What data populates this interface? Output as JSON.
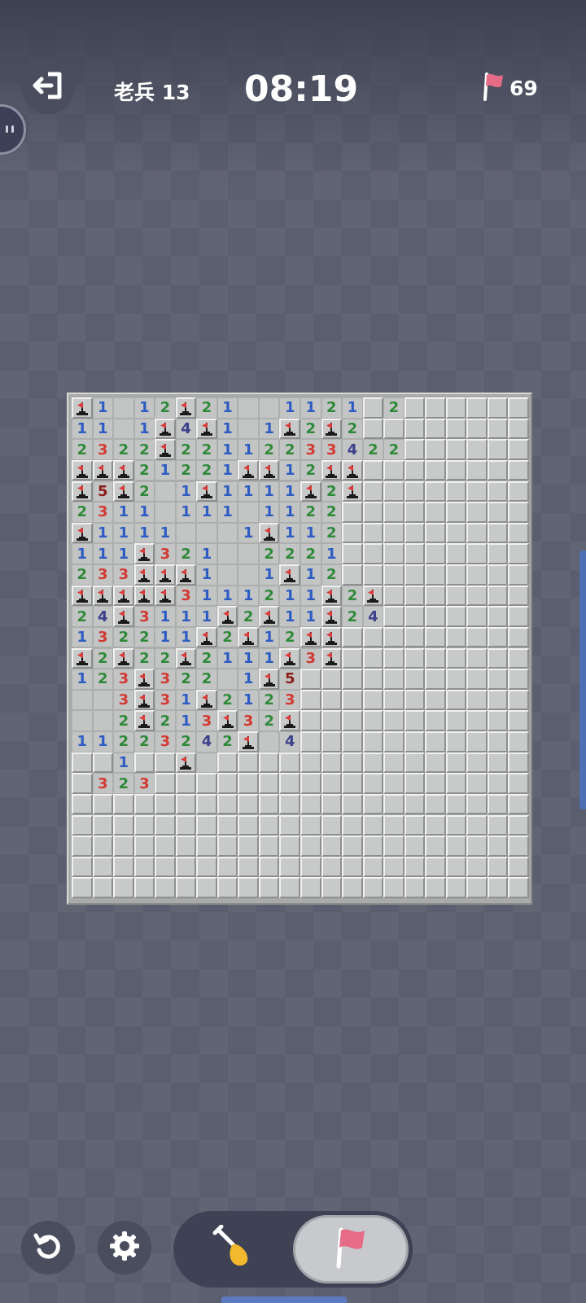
{
  "header": {
    "level_label": "老兵 13",
    "timer": "08:19",
    "flags_remaining": "69"
  },
  "board": {
    "cols": 22,
    "rows": 24,
    "rows_data": [
      "F1.12F21..1121H2HHHHHHHH",
      "11.1F4F1.1F2F2HHHHHHHHHH",
      "2322F22112233422HHHHHHHH",
      "FFF21221FF12FFHHHHHHHHHH",
      "F5F2.1F1111F2FHHHHHHHHHH",
      "2311.111.1122HHHHHHHHHHH",
      "F1111...1F112HHHHHHHHHHH",
      "111F321..2221HHHHHHHHHHH",
      "233FFF1..1F12HHHHHHHHHHH",
      "FFFFF3111211F2FHHHHHHHHH",
      "24F3111F2F11F24HHHHHHHHH",
      "132211F2F12FFHHHHHHHHHHH",
      "F2F22F2111F3FHHHHHHHHHHH",
      "123F322.1F5HHHHHHHHHHHHH",
      "..3F31F2123HHHHHHHHHHHHH",
      "..2F213F32FHHHHHHHHHHHHH",
      "11223242F.4HHHHHHHHHHHHH",
      "HH1HHF.HHHHHHHHHHHHHHHHH",
      "H323HHHHHHHHHHHHHHHHHHHH",
      "HHHHHHHHHHHHHHHHHHHHHHHH",
      "HHHHHHHHHHHHHHHHHHHHHHHH",
      "HHHHHHHHHHHHHHHHHHHHHHHH",
      "HHHHHHHHHHHHHHHHHHHHHHHH",
      "HHHHHHHHHHHHHHHHHHHHHHHH"
    ]
  },
  "controls": {
    "mode": "flag"
  },
  "icons": {
    "exit": "exit-icon",
    "chat": "chat-icon",
    "flag": "flag-icon",
    "undo": "undo-icon",
    "settings": "gear-icon",
    "dig": "shovel-icon"
  },
  "colors": {
    "one": "#2d5cc2",
    "two": "#2f8a3a",
    "three": "#d23a33",
    "four": "#3c3f8a",
    "five": "#8a1d18",
    "flag": "#d93a3a"
  }
}
